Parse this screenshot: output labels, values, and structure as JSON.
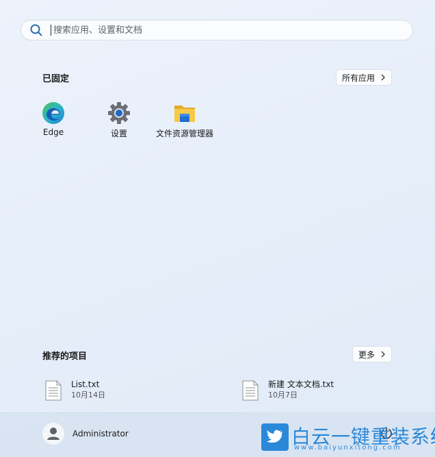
{
  "search": {
    "placeholder": "搜索应用、设置和文档"
  },
  "pinned": {
    "title": "已固定",
    "all_apps_label": "所有应用",
    "apps": [
      {
        "label": "Edge",
        "icon": "edge-icon"
      },
      {
        "label": "设置",
        "icon": "settings-gear-icon"
      },
      {
        "label": "文件资源管理器",
        "icon": "file-explorer-folder-icon"
      }
    ]
  },
  "recommended": {
    "title": "推荐的项目",
    "more_label": "更多",
    "items": [
      {
        "name": "List.txt",
        "date": "10月14日",
        "icon": "text-document-icon"
      },
      {
        "name": "新建 文本文档.txt",
        "date": "10月7日",
        "icon": "text-document-icon"
      }
    ]
  },
  "footer": {
    "username": "Administrator",
    "power_icon": "power-icon"
  },
  "watermark": {
    "title": "白云一键重装系统",
    "url": "www.baiyunxitong.com"
  },
  "colors": {
    "accent": "#2a88d8",
    "edge_blue": "#1f7fd6",
    "edge_green": "#4fc35a",
    "folder_yellow": "#f7c948",
    "folder_blue": "#1d6fd1"
  }
}
